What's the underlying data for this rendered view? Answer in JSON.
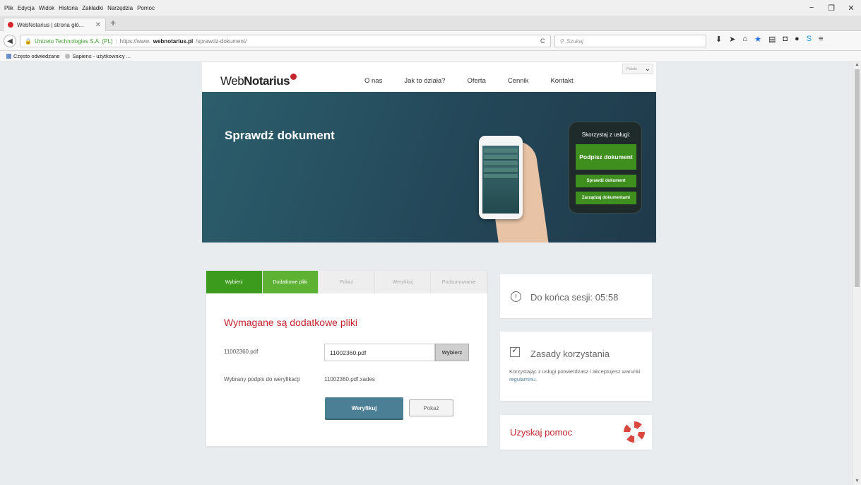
{
  "browser": {
    "menu": [
      "Plik",
      "Edycja",
      "Widok",
      "Historia",
      "Zakładki",
      "Narzędzia",
      "Pomoc"
    ],
    "tab_title": "WebNotarius | strona głó...",
    "identity": "Unizeto Technologies S.A. (PL)",
    "url_prefix": "https://www.",
    "url_host": "webnotarius.pl",
    "url_path": "/sprawdz-dokument/",
    "search_placeholder": "Szukaj",
    "bookmarks": [
      "Często odwiedzane",
      "Sapiens - użytkownicy ..."
    ]
  },
  "header": {
    "logo_prefix": "Web",
    "logo_bold": "Notarius",
    "nav": [
      "O nas",
      "Jak to działa?",
      "Oferta",
      "Cennik",
      "Kontakt"
    ],
    "language": "Polski"
  },
  "hero": {
    "title": "Sprawdź dokument",
    "panel_caption": "Skorzystaj z usługi:",
    "sign_button": "Podpisz dokument",
    "verify_button": "Sprawdź dokument",
    "manage_button": "Zarządzaj dokumentami"
  },
  "wizard": {
    "steps": [
      "Wybierz",
      "Dodatkowe pliki",
      "Pokaż",
      "Weryfikuj",
      "Podsumowanie"
    ],
    "title": "Wymagane są dodatkowe pliki",
    "file_label": "11002360.pdf",
    "file_value": "11002360.pdf",
    "choose_button": "Wybierz",
    "signature_label": "Wybrany podpis do weryfikacji",
    "signature_value": "11002360.pdf.xades",
    "verify_button": "Weryfikuj",
    "show_button": "Pokaż"
  },
  "sidebar": {
    "session_text": "Do końca sesji: 05:58",
    "terms_title": "Zasady korzystania",
    "terms_body": "Korzystając z usługi potwierdzasz i akceptujesz warunki ",
    "terms_link": "regulaminu",
    "help_title": "Uzyskaj pomoc"
  },
  "colors": {
    "brand_red": "#c4262e",
    "step_green": "#3c9a1d",
    "step_active_green": "#5db234",
    "verify_blue": "#4a7f96"
  }
}
